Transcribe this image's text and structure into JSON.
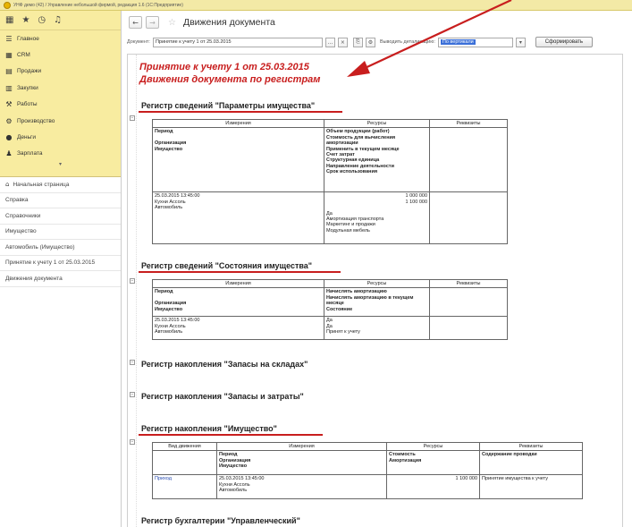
{
  "window": {
    "title": "УНФ демо (42) / Управление небольшой фирмой, редакция 1.6 (1С:Предприятие)"
  },
  "iconbar": {
    "icons": [
      "grid-icon",
      "star-icon",
      "history-icon",
      "bell-icon"
    ]
  },
  "sections": [
    {
      "label": "Главное",
      "icon": "☰"
    },
    {
      "label": "CRM",
      "icon": "▦"
    },
    {
      "label": "Продажи",
      "icon": "▤"
    },
    {
      "label": "Закупки",
      "icon": "▥"
    },
    {
      "label": "Работы",
      "icon": "⚒"
    },
    {
      "label": "Производство",
      "icon": "⚙"
    },
    {
      "label": "Деньги",
      "icon": "●"
    },
    {
      "label": "Зарплата",
      "icon": "♟"
    }
  ],
  "open_windows": [
    {
      "label": "Начальная страница"
    },
    {
      "label": "Справка"
    },
    {
      "label": "Справочники"
    },
    {
      "label": "Имущество"
    },
    {
      "label": "Автомобиль (Имущество)"
    },
    {
      "label": "Принятие к учету 1 от 25.03.2015"
    },
    {
      "label": "Движения документа"
    }
  ],
  "header": {
    "title": "Движения документа",
    "back": "←",
    "forward": "→",
    "star": "☆"
  },
  "toolbar": {
    "document_label": "Документ:",
    "document_value": "Принятие к учету 1 от 25.03.2015",
    "detail_label": "Выводить детализацию:",
    "detail_value": "По вертикали",
    "generate_button": "Сформировать"
  },
  "report": {
    "title_line1": "Принятие к учету 1 от 25.03.2015",
    "title_line2": "Движения документа по регистрам",
    "reg1": {
      "title": "Регистр сведений \"Параметры имущества\"",
      "headers": [
        "Измерения",
        "Ресурсы",
        "Реквизиты"
      ],
      "dims_head": [
        "Период",
        "",
        "Организация",
        "Имущество"
      ],
      "res_head": [
        "Объем продукции (работ)",
        "Стоимость для вычисления амортизации",
        "Применить в текущем месяце",
        "Счет затрат",
        "Структурная единица",
        "Направление деятельности",
        "Срок использования"
      ],
      "dims_row": [
        "25.03.2015 13:45:00",
        "Кухни Ассоль",
        "Автомобиль"
      ],
      "res_row": [
        "1 000 000",
        "1 100 000",
        "",
        "Да",
        "Амортизация транспорта",
        "Маркетинг и продажи",
        "Модульная мебель"
      ]
    },
    "reg2": {
      "title": "Регистр сведений \"Состояния имущества\"",
      "headers": [
        "Измерения",
        "Ресурсы",
        "Реквизиты"
      ],
      "dims_head": [
        "Период",
        "",
        "Организация",
        "Имущество"
      ],
      "res_head": [
        "Начислять амортизацию",
        "Начислять амортизацию в текущем месяце",
        "Состояние"
      ],
      "dims_row": [
        "25.03.2015 13:45:00",
        "Кухни Ассоль",
        "Автомобиль"
      ],
      "res_row": [
        "Да",
        "Да",
        "Принят к учету"
      ]
    },
    "reg3": {
      "title": "Регистр накопления \"Запасы на складах\""
    },
    "reg4": {
      "title": "Регистр накопления \"Запасы и затраты\""
    },
    "reg5": {
      "title": "Регистр накопления \"Имущество\"",
      "headers": [
        "Вид движения",
        "Измерения",
        "Ресурсы",
        "Реквизиты"
      ],
      "dims_head": [
        "Период",
        "Организация",
        "Имущество"
      ],
      "res_head": [
        "Стоимость",
        "Амортизация"
      ],
      "req_head": "Содержание проводки",
      "movement": "Приход",
      "dims_row": [
        "25.03.2015 13:45:00",
        "Кухни Ассоль",
        "Автомобиль"
      ],
      "res_row": "1 100 000",
      "req_row": "Принятие имущества к учету"
    },
    "reg6": {
      "title": "Регистр бухгалтерии \"Управленческий\""
    }
  },
  "colors": {
    "accent_red": "#c81e1e",
    "sections_bg": "#f8eca0"
  }
}
